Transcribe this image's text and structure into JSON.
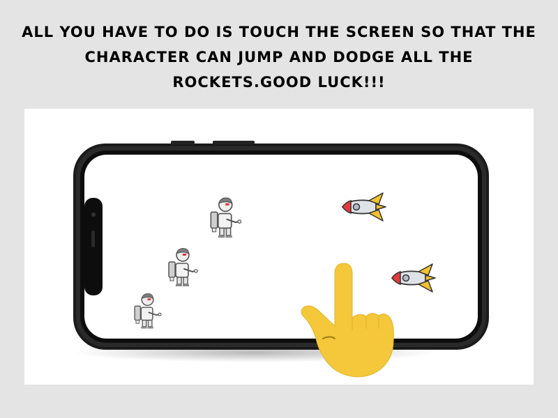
{
  "instructions": {
    "text": "ALL YOU HAVE TO DO IS TOUCH THE SCREEN SO THAT THE CHARACTER CAN JUMP AND DODGE ALL THE ROCKETS.GOOD LUCK!!!"
  },
  "scene": {
    "device": "smartphone-landscape",
    "characters": 3,
    "rockets": 2,
    "gesture": "tap-hand-icon"
  },
  "colors": {
    "background": "#e4e4e4",
    "panel": "#ffffff",
    "phone_frame": "#111111",
    "hand": "#f4c83a",
    "rocket_body": "#d9dde3",
    "rocket_nose": "#e23b3b",
    "rocket_fin": "#f2c230"
  }
}
